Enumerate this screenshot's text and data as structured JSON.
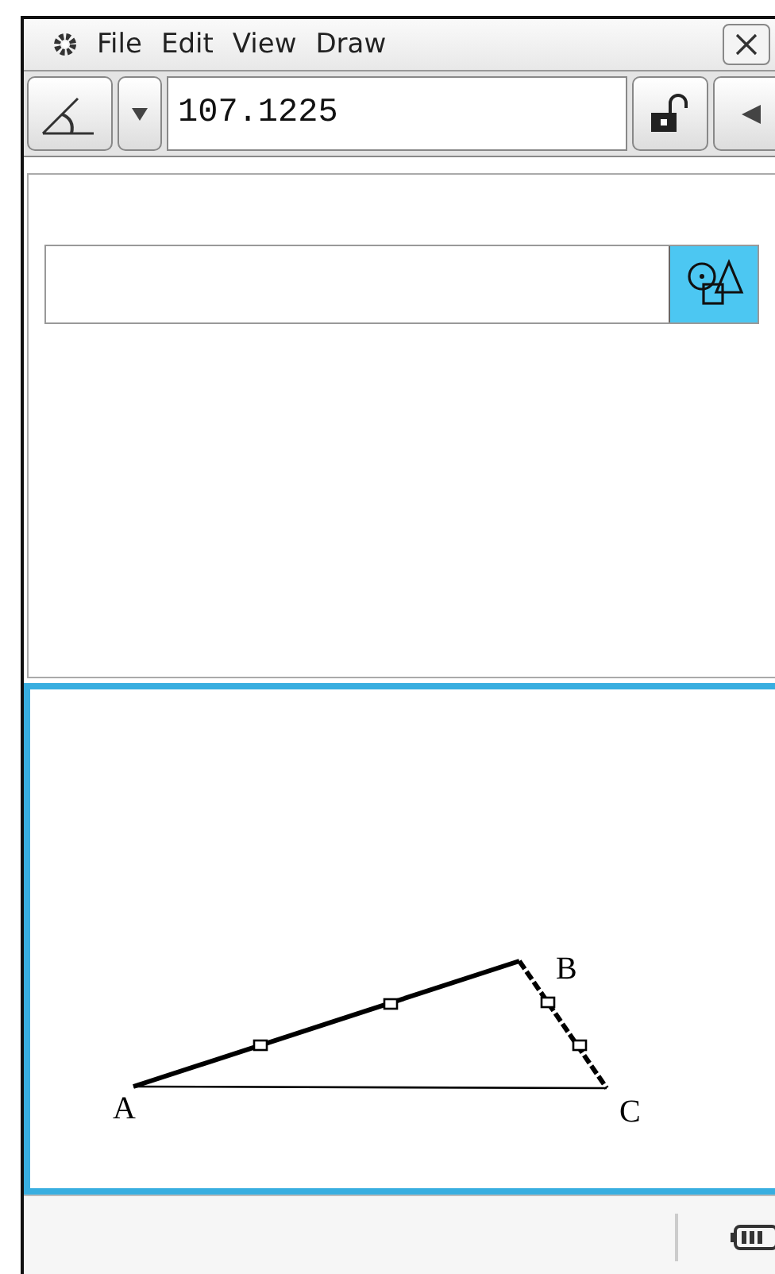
{
  "menu_bar": {
    "items": [
      "File",
      "Edit",
      "View",
      "Draw"
    ]
  },
  "toolbar": {
    "measure_value": "107.1225",
    "locked": false
  },
  "geometry": {
    "points": [
      {
        "label": "A"
      },
      {
        "label": "B"
      },
      {
        "label": "C"
      }
    ]
  }
}
